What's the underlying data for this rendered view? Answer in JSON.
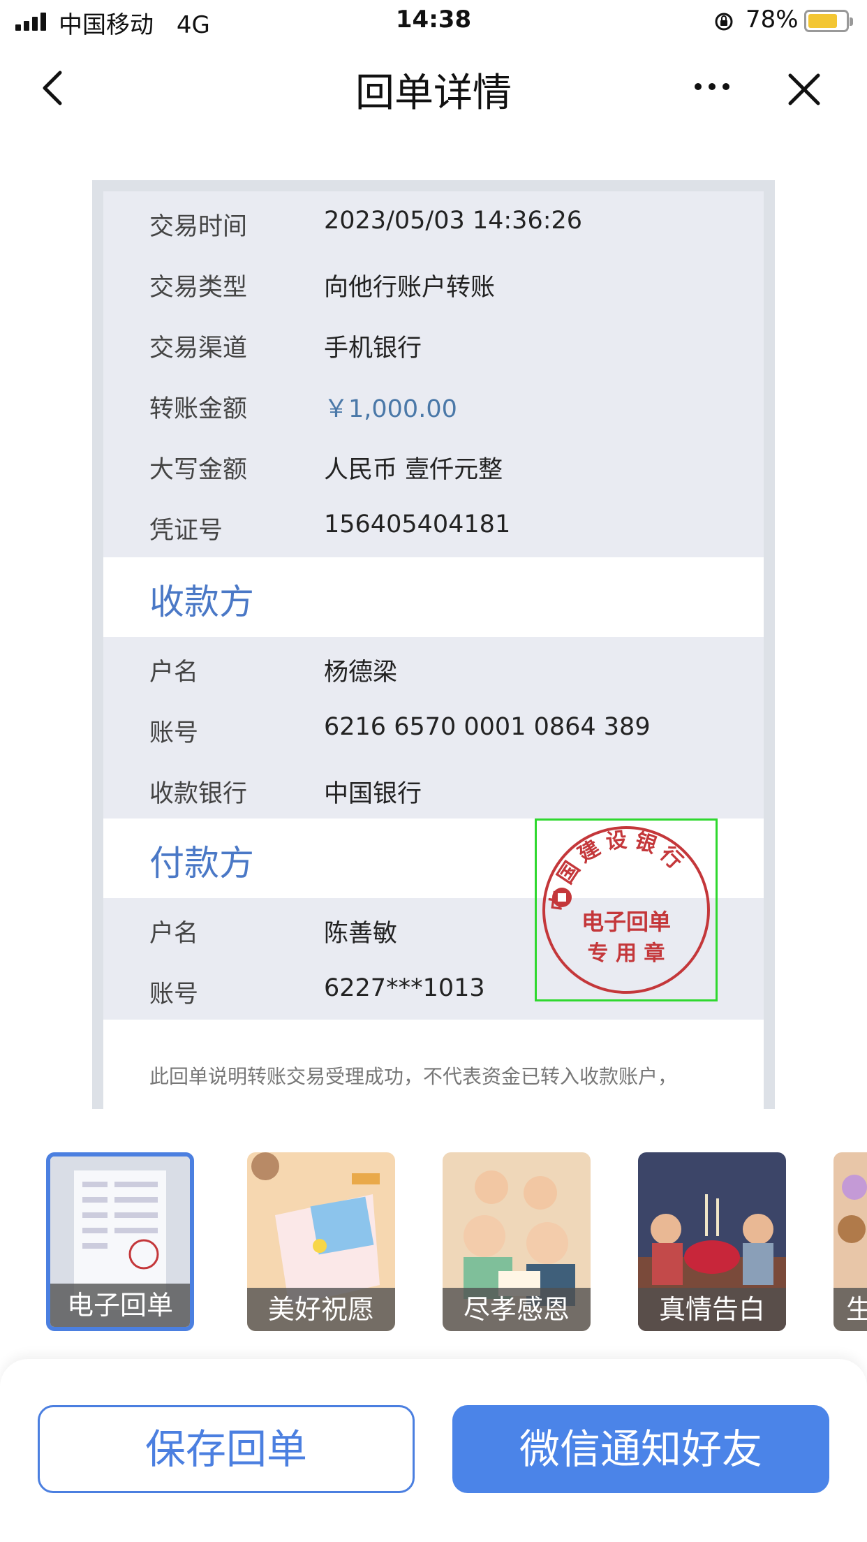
{
  "status_bar": {
    "carrier": "中国移动",
    "network": "4G",
    "time": "14:38",
    "battery": "78%",
    "battery_level": 0.78
  },
  "nav": {
    "title": "回单详情"
  },
  "receipt": {
    "rows": [
      {
        "label": "交易时间",
        "value": "2023/05/03 14:36:26"
      },
      {
        "label": "交易类型",
        "value": "向他行账户转账"
      },
      {
        "label": "交易渠道",
        "value": "手机银行"
      },
      {
        "label": "转账金额",
        "value": "￥1,000.00"
      },
      {
        "label": "大写金额",
        "value": "人民币 壹仟元整"
      },
      {
        "label": "凭证号",
        "value": "156405404181"
      }
    ],
    "payee": {
      "title": "收款方",
      "rows": [
        {
          "label": "户名",
          "value": "杨德梁"
        },
        {
          "label": "账号",
          "value": "6216 6570 0001 0864 389"
        },
        {
          "label": "收款银行",
          "value": "中国银行"
        }
      ]
    },
    "payer": {
      "title": "付款方",
      "rows": [
        {
          "label": "户名",
          "value": "陈善敏"
        },
        {
          "label": "账号",
          "value": "6227***1013"
        }
      ]
    },
    "notice": "此回单说明转账交易受理成功，不代表资金已转入收款账户，",
    "stamp": {
      "bank": "中国建设银行",
      "line1": "电子回单",
      "line2": "专 用 章"
    }
  },
  "themes": [
    {
      "label": "电子回单",
      "selected": true
    },
    {
      "label": "美好祝愿",
      "selected": false
    },
    {
      "label": "尽孝感恩",
      "selected": false
    },
    {
      "label": "真情告白",
      "selected": false
    },
    {
      "label": "生",
      "selected": false
    }
  ],
  "buttons": {
    "save": "保存回单",
    "wechat": "微信通知好友"
  },
  "colors": {
    "accent": "#4b7fe0",
    "section_title": "#4a78c6",
    "amount": "#4a78a8",
    "stamp_red": "#c4373a",
    "stamp_box": "#2fd82f"
  }
}
